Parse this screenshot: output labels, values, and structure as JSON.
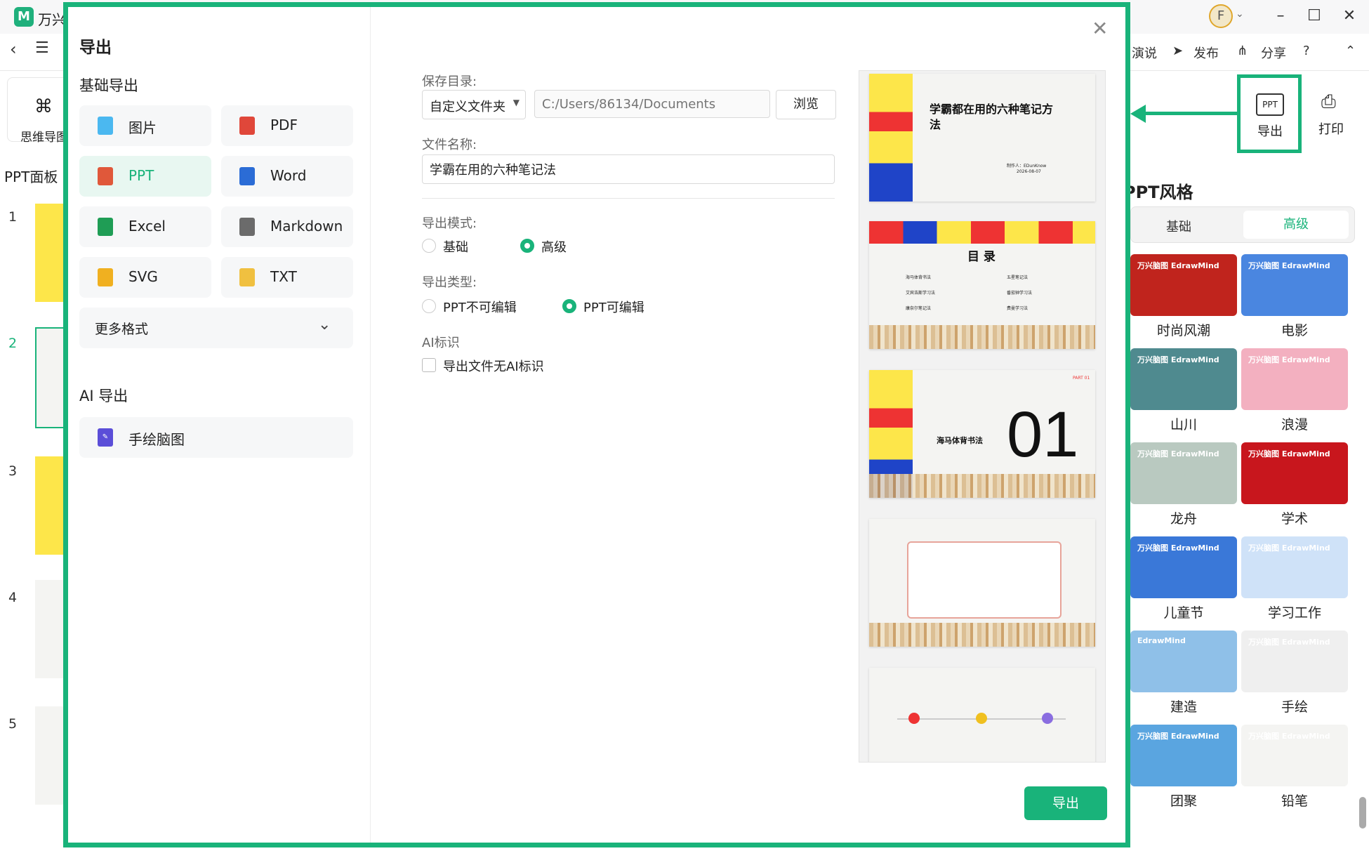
{
  "app": {
    "name": "万兴",
    "avatar_letter": "F"
  },
  "toolbar": {
    "present_label": "演说",
    "publish_label": "发布",
    "share_label": "分享",
    "help_label": "?"
  },
  "left_tools": {
    "mindmap_label": "思维导图"
  },
  "ppt_panel": {
    "title": "PPT面板",
    "slide_numbers": [
      "1",
      "2",
      "3",
      "4",
      "5"
    ]
  },
  "ribbon": {
    "export_label": "导出",
    "print_label": "打印",
    "export_icon_text": "PPT"
  },
  "styles_panel": {
    "title": "PPT风格",
    "tab_basic": "基础",
    "tab_advanced": "高级",
    "items": [
      {
        "label": "时尚风潮",
        "color": "#c0241d",
        "card_text": "万兴脑图 EdrawMind"
      },
      {
        "label": "电影",
        "color": "#4a86e0",
        "card_text": "万兴脑图 EdrawMind"
      },
      {
        "label": "山川",
        "color": "#4f8a8f",
        "card_text": "万兴脑图 EdrawMind"
      },
      {
        "label": "浪漫",
        "color": "#f3b0c0",
        "card_text": "万兴脑图 EdrawMind"
      },
      {
        "label": "龙舟",
        "color": "#b9c9c0",
        "card_text": "万兴脑图 EdrawMind"
      },
      {
        "label": "学术",
        "color": "#c8161d",
        "card_text": "万兴脑图 EdrawMind"
      },
      {
        "label": "儿童节",
        "color": "#3a78d8",
        "card_text": "万兴脑图 EdrawMind"
      },
      {
        "label": "学习工作",
        "color": "#cfe2f8",
        "card_text": "万兴脑图 EdrawMind"
      },
      {
        "label": "建造",
        "color": "#8fc0e8",
        "card_text": "EdrawMind"
      },
      {
        "label": "手绘",
        "color": "#efefef",
        "card_text": "万兴脑图 EdrawMind"
      },
      {
        "label": "团聚",
        "color": "#5aa5e0",
        "card_text": "万兴脑图 EdrawMind"
      },
      {
        "label": "铅笔",
        "color": "#f4f4f2",
        "card_text": "万兴脑图 EdrawMind"
      }
    ]
  },
  "dialog": {
    "title": "导出",
    "basic_section": "基础导出",
    "formats": [
      {
        "label": "图片",
        "icon": "image-icon",
        "color": "#4bb8f0"
      },
      {
        "label": "PDF",
        "icon": "pdf-icon",
        "color": "#e0473a"
      },
      {
        "label": "PPT",
        "icon": "ppt-icon",
        "color": "#e0583a"
      },
      {
        "label": "Word",
        "icon": "word-icon",
        "color": "#2b6cd6"
      },
      {
        "label": "Excel",
        "icon": "excel-icon",
        "color": "#1f9d55"
      },
      {
        "label": "Markdown",
        "icon": "markdown-icon",
        "color": "#6b6b6b"
      },
      {
        "label": "SVG",
        "icon": "svg-icon",
        "color": "#f0b020"
      },
      {
        "label": "TXT",
        "icon": "txt-icon",
        "color": "#f0c040"
      }
    ],
    "selected_format": "PPT",
    "more_formats": "更多格式",
    "ai_section": "AI 导出",
    "ai_formats": [
      {
        "label": "手绘脑图",
        "icon": "ai-pen-icon",
        "color": "#5b4ed8"
      }
    ],
    "save_dir_label": "保存目录:",
    "dir_option": "自定义文件夹",
    "dir_path_placeholder": "C:/Users/86134/Documents",
    "browse_label": "浏览",
    "file_name_label": "文件名称:",
    "file_name": "学霸在用的六种笔记法",
    "mode_label": "导出模式:",
    "mode_basic": "基础",
    "mode_advanced": "高级",
    "type_label": "导出类型:",
    "type_noneditable": "PPT不可编辑",
    "type_editable": "PPT可编辑",
    "ai_mark_label": "AI标识",
    "ai_mark_checkbox": "导出文件无AI标识",
    "export_button": "导出",
    "preview": {
      "slide1_title": "学霸都在用的六种笔记方法",
      "slide1_author": "制作人：EDunKnow",
      "slide1_date": "2026-08-07",
      "slide2_title": "目 录",
      "slide2_items": [
        "海马体背书法",
        "五星笔记法",
        "艾宾浩斯学习法",
        "番茄钟学习法",
        "康奈尔笔记法",
        "费曼学习法"
      ],
      "slide3_part": "PART 01",
      "slide3_title": "海马体背书法",
      "slide3_number": "01"
    }
  }
}
